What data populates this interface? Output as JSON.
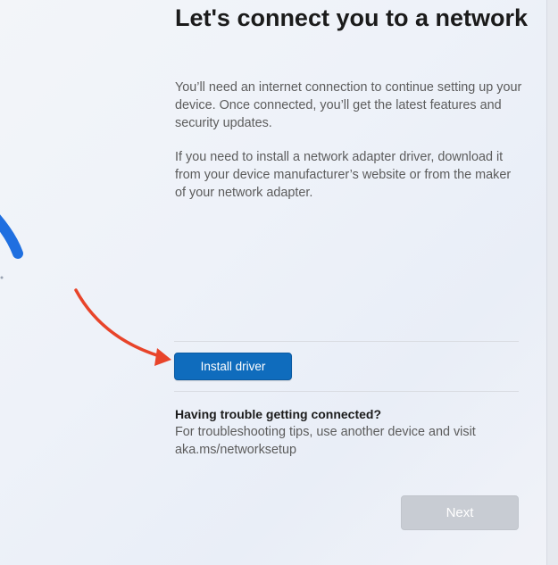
{
  "page": {
    "title": "Let's connect you to a network",
    "paragraphs": [
      "You’ll need an internet connection to continue setting up your device. Once connected, you’ll get the latest features and security updates.",
      "If you need to install a network adapter driver, download it from your device manufacturer’s website or from the maker of your network adapter."
    ]
  },
  "actions": {
    "install_driver_label": "Install driver",
    "next_label": "Next",
    "next_enabled": false
  },
  "help": {
    "title": "Having trouble getting connected?",
    "text": "For troubleshooting tips, use another device and visit aka.ms/networksetup"
  },
  "colors": {
    "primary_button": "#0f6cbd",
    "disabled_button": "#c8ccd3",
    "annotation_arrow": "#e8442a",
    "illustration_blue": "#1f6fe0"
  },
  "icons": {
    "illustration": "network-illustration-icon",
    "annotation": "red-arrow-icon"
  }
}
